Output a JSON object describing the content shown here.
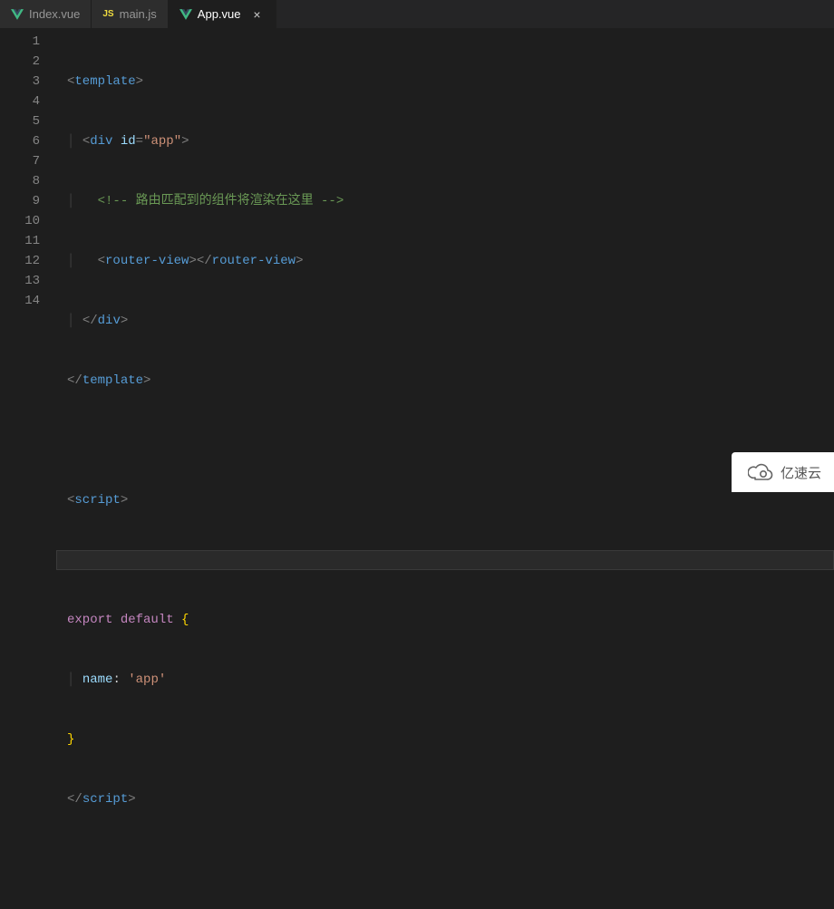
{
  "tabs": [
    {
      "label": "Index.vue",
      "icon": "vue",
      "active": false
    },
    {
      "label": "main.js",
      "icon": "js",
      "active": false
    },
    {
      "label": "App.vue",
      "icon": "vue",
      "active": true
    }
  ],
  "gutter": [
    "1",
    "2",
    "3",
    "4",
    "5",
    "6",
    "7",
    "8",
    "9",
    "10",
    "11",
    "12",
    "13",
    "14"
  ],
  "code": {
    "l1": {
      "a": "<",
      "b": "template",
      "c": ">"
    },
    "l2": {
      "pre": "  ",
      "a": "<",
      "b": "div",
      "sp": " ",
      "attr": "id",
      "eq": "=",
      "q1": "\"",
      "str": "app",
      "q2": "\"",
      "c": ">"
    },
    "l3": {
      "pre": "    ",
      "cmt": "<!-- 路由匹配到的组件将渲染在这里 -->"
    },
    "l4": {
      "pre": "    ",
      "a": "<",
      "b": "router-view",
      "c": ">",
      "d": "</",
      "e": "router-view",
      "f": ">"
    },
    "l5": {
      "pre": "  ",
      "a": "</",
      "b": "div",
      "c": ">"
    },
    "l6": {
      "a": "</",
      "b": "template",
      "c": ">"
    },
    "l7": {
      "blank": ""
    },
    "l8": {
      "a": "<",
      "b": "script",
      "c": ">"
    },
    "l9": {
      "blank": ""
    },
    "l10": {
      "kw1": "export",
      "sp": " ",
      "kw2": "default",
      "sp2": " ",
      "brc": "{"
    },
    "l11": {
      "pre": "  ",
      "prop": "name",
      "colon": ":",
      "sp": " ",
      "str": "'app'"
    },
    "l12": {
      "brc": "}"
    },
    "l13": {
      "a": "</",
      "b": "script",
      "c": ">"
    },
    "l14": {
      "blank": ""
    }
  },
  "close_glyph": "×",
  "watermark": {
    "text": "亿速云"
  }
}
